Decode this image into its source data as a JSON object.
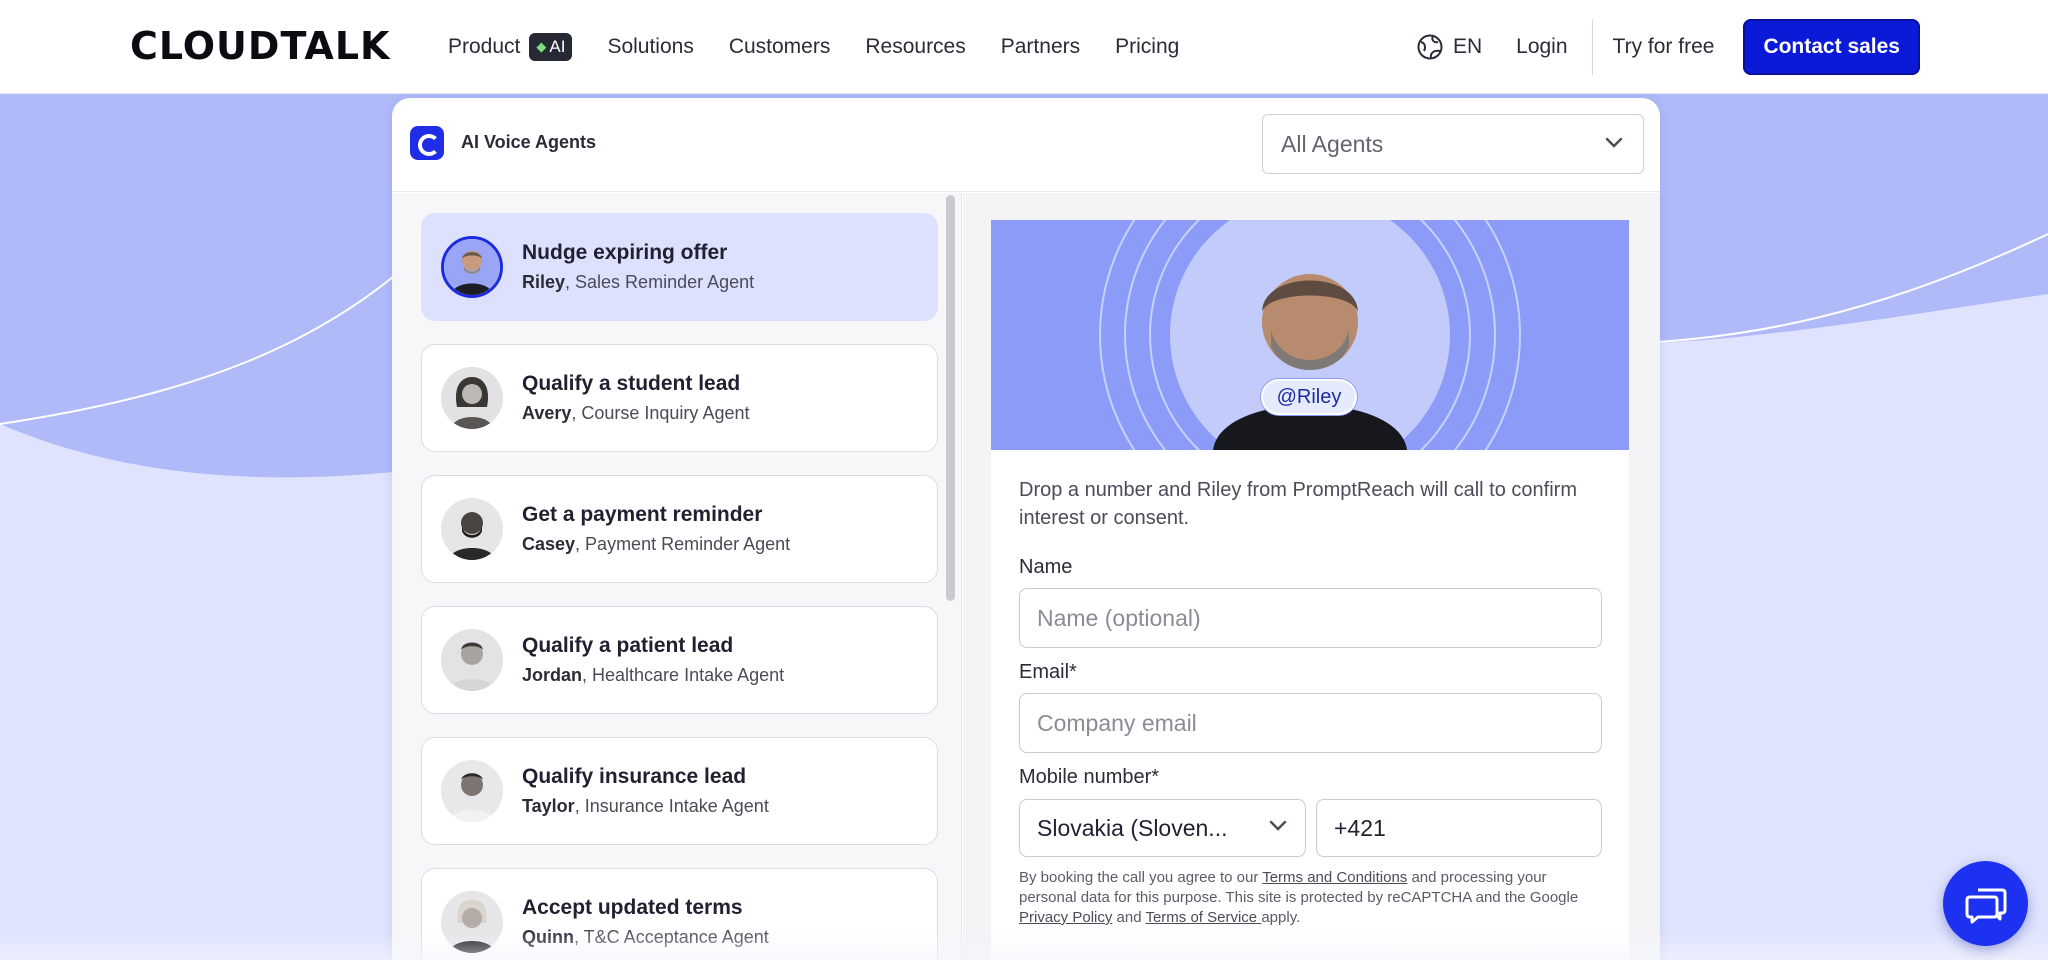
{
  "nav": {
    "logo": "CLOUDTALK",
    "links": [
      {
        "label": "Product",
        "badge": "AI"
      },
      {
        "label": "Solutions"
      },
      {
        "label": "Customers"
      },
      {
        "label": "Resources"
      },
      {
        "label": "Partners"
      },
      {
        "label": "Pricing"
      }
    ],
    "lang": "EN",
    "login": "Login",
    "try_free": "Try for free",
    "contact_sales": "Contact sales"
  },
  "panel": {
    "title": "AI Voice Agents",
    "filter": "All Agents"
  },
  "agents": [
    {
      "title": "Nudge expiring offer",
      "name": "Riley",
      "role": ", Sales Reminder Agent"
    },
    {
      "title": "Qualify a student lead",
      "name": "Avery",
      "role": ", Course Inquiry Agent"
    },
    {
      "title": "Get a payment reminder",
      "name": "Casey",
      "role": ", Payment Reminder Agent"
    },
    {
      "title": "Qualify a patient lead",
      "name": "Jordan",
      "role": ", Healthcare Intake Agent"
    },
    {
      "title": "Qualify insurance lead",
      "name": "Taylor",
      "role": ", Insurance Intake Agent"
    },
    {
      "title": "Accept updated terms",
      "name": "Quinn",
      "role": ", T&C Acceptance Agent"
    }
  ],
  "detail": {
    "handle": "@Riley",
    "intro": "Drop a number and Riley from PromptReach will call to confirm interest or consent.",
    "name_label": "Name",
    "name_placeholder": "Name (optional)",
    "email_label": "Email*",
    "email_placeholder": "Company email",
    "mobile_label": "Mobile number*",
    "country": "Slovakia (Sloven...",
    "phone_prefix": "+421",
    "legal_1": "By booking the call you agree to our ",
    "legal_terms": "Terms and Conditions",
    "legal_2": " and processing your personal data for this purpose. This site is protected by reCAPTCHA and the Google ",
    "legal_privacy": "Privacy Policy",
    "legal_3": " and ",
    "legal_tos": "Terms of Service ",
    "legal_4": "apply."
  },
  "colors": {
    "brand_blue": "#0b1ad6",
    "hero_blue": "#8c9bf7",
    "active_item": "#dde1fd",
    "background": "#dfe3fd"
  },
  "icons": [
    "globe-icon",
    "chevron-down-icon",
    "chat-icon",
    "cloudtalk-logo-icon"
  ]
}
